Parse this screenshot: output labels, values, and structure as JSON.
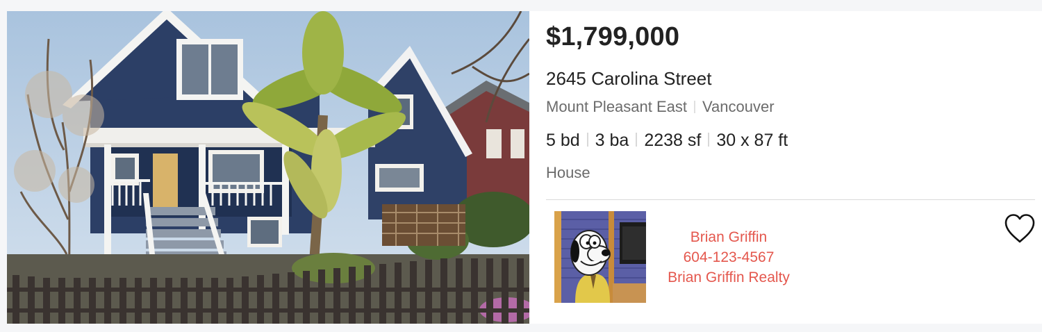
{
  "listing": {
    "price": "$1,799,000",
    "address": "2645 Carolina Street",
    "neighborhood": "Mount Pleasant East",
    "city": "Vancouver",
    "beds": "5 bd",
    "baths": "3 ba",
    "area": "2238 sf",
    "lot": "30 x 87 ft",
    "property_type": "House"
  },
  "agent": {
    "name": "Brian Griffin",
    "phone": "604-123-4567",
    "brokerage": "Brian Griffin Realty",
    "text_color": "#e4574d"
  },
  "actions": {
    "favorite_icon": "heart-outline-icon"
  }
}
